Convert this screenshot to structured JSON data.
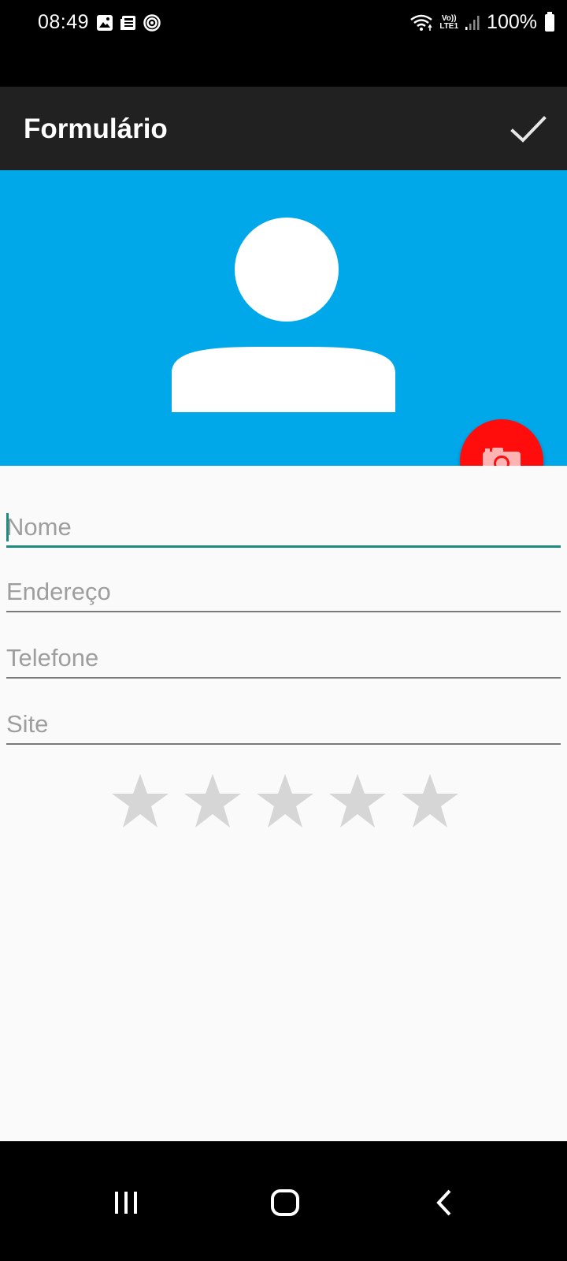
{
  "status_bar": {
    "time": "08:49",
    "battery": "100%",
    "network_badge_top": "Vo))",
    "network_badge_bottom": "LTE1",
    "left_icons": [
      "gallery-icon",
      "news-icon",
      "target-icon"
    ],
    "right_icons": [
      "wifi-icon",
      "signal-icon",
      "battery-icon"
    ]
  },
  "app_bar": {
    "title": "Formulário",
    "action_icon": "check-icon"
  },
  "header": {
    "background_color": "#00A8EA",
    "avatar_icon": "person-icon"
  },
  "fab": {
    "icon": "camera-icon",
    "color": "#FF0D0D"
  },
  "form": {
    "fields": [
      {
        "placeholder": "Nome",
        "value": ""
      },
      {
        "placeholder": "Endereço",
        "value": ""
      },
      {
        "placeholder": "Telefone",
        "value": ""
      },
      {
        "placeholder": "Site",
        "value": ""
      }
    ],
    "rating": {
      "value": 0,
      "max": 5,
      "star_color": "#D6D6D6"
    },
    "accent_color": "#1E8A7E"
  },
  "nav_bar": {
    "icons": [
      "recents-icon",
      "home-icon",
      "back-icon"
    ]
  }
}
